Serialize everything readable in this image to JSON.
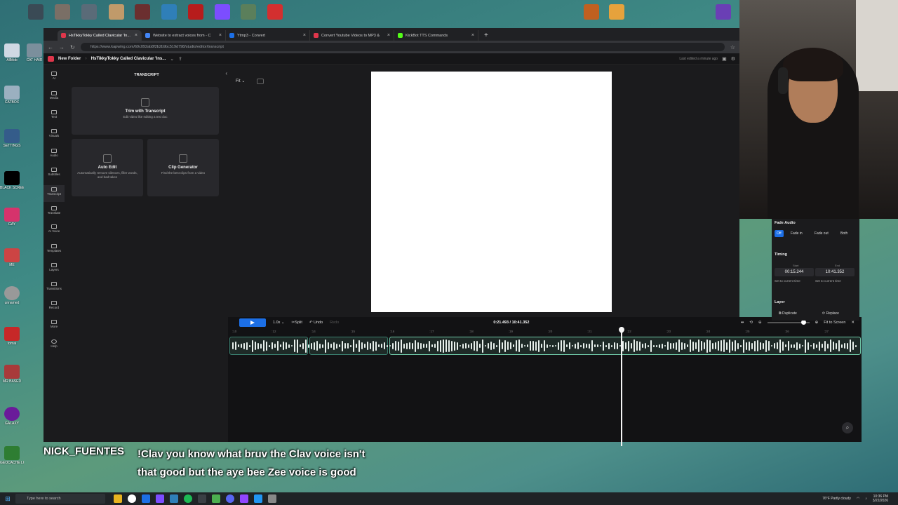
{
  "browser": {
    "tabs": [
      {
        "title": "HsTikkyTokky Called Clavicular 'In...",
        "color": "#e0364b",
        "active": true
      },
      {
        "title": "Website to extract voices from - C",
        "color": "#4285f4",
        "active": false
      },
      {
        "title": "Ytmp3 - Convert",
        "color": "#1c6fe6",
        "active": false
      },
      {
        "title": "Convert Youtube Videos to MP3 &",
        "color": "#e0364b",
        "active": false
      },
      {
        "title": "KickBot TTS Commands",
        "color": "#53fc18",
        "active": false
      }
    ],
    "new_tab": "+",
    "url": "https://www.kapwing.com/69c092ab8f2b2b9bc519d798/studio/editor/transcript"
  },
  "app": {
    "folder": "New Folder",
    "project": "HsTikkyTokky Called Clavicular 'Ins...",
    "last_edited": "Last edited a minute ago",
    "rail": [
      {
        "label": "AI"
      },
      {
        "label": "Media"
      },
      {
        "label": "Text"
      },
      {
        "label": "Visuals"
      },
      {
        "label": "Audio"
      },
      {
        "label": "Subtitles"
      },
      {
        "label": "Transcript"
      },
      {
        "label": "Translate"
      },
      {
        "label": "AI Voice"
      },
      {
        "label": "Templates"
      },
      {
        "label": "Layers"
      },
      {
        "label": "Transitions"
      },
      {
        "label": "Record"
      },
      {
        "label": "More"
      },
      {
        "label": "Help"
      }
    ],
    "panel": {
      "title": "TRANSCRIPT",
      "trim_title": "Trim with Transcript",
      "trim_sub": "Edit video like editing a text doc",
      "auto_title": "Auto Edit",
      "auto_sub": "Automatically remove silences, filler words, and bad takes",
      "clip_title": "Clip Generator",
      "clip_sub": "Find the best clips from a video"
    },
    "stage": {
      "fit": "Fit"
    },
    "timeline": {
      "speed": "1.0x",
      "split": "Split",
      "undo": "Undo",
      "redo": "Redo",
      "time": "0:21.493 / 10:41.352",
      "fit_to_screen": "Fit to Screen",
      "ticks": [
        ":10",
        ":12",
        ":14",
        ":15",
        ":16",
        ":17",
        ":18",
        ":19",
        ":20",
        ":21",
        ":22",
        ":23",
        ":24",
        ":25",
        ":26",
        ":27"
      ]
    },
    "props": {
      "fade_audio": "Fade Audio",
      "fade_options": [
        "Off",
        "Fade in",
        "Fade out",
        "Both"
      ],
      "timing": "Timing",
      "start_label": "Start",
      "end_label": "End",
      "start": "00:15.244",
      "end": "10:41.352",
      "set_current": "Set to current time",
      "layer": "Layer",
      "duplicate": "Duplicate",
      "replace": "Replace"
    }
  },
  "chat": {
    "user": "NICK_FUENTES",
    "message": "!Clav you know what bruv the Clav voice isn't that good but the aye bee Zee voice is good"
  },
  "taskbar": {
    "search": "Type here to search",
    "weather": "76°F  Partly cloudy",
    "time": "10:36 PM",
    "date": "3/22/2026"
  },
  "desktop": {
    "icons_left": [
      {
        "label": "AllMob",
        "color": "#cfd8e3"
      },
      {
        "label": "CAT HAIR",
        "color": "#7b8f9c"
      },
      {
        "label": "CATBOX",
        "color": "#9bb0c0"
      },
      {
        "label": "SETTINGS",
        "color": "#345c8a"
      },
      {
        "label": "BLACK SCREEN",
        "color": "#000000"
      },
      {
        "label": "GAY",
        "color": "#d6336c"
      },
      {
        "label": "ME",
        "color": "#c44"
      },
      {
        "label": "unnamed",
        "color": "#999999"
      },
      {
        "label": "tomai",
        "color": "#c62828"
      },
      {
        "label": "MR BASED",
        "color": "#a83a3a"
      },
      {
        "label": "GALAXY",
        "color": "#6a1b9a"
      },
      {
        "label": "GEOCACHE LOGO",
        "color": "#2e7d32"
      }
    ]
  }
}
